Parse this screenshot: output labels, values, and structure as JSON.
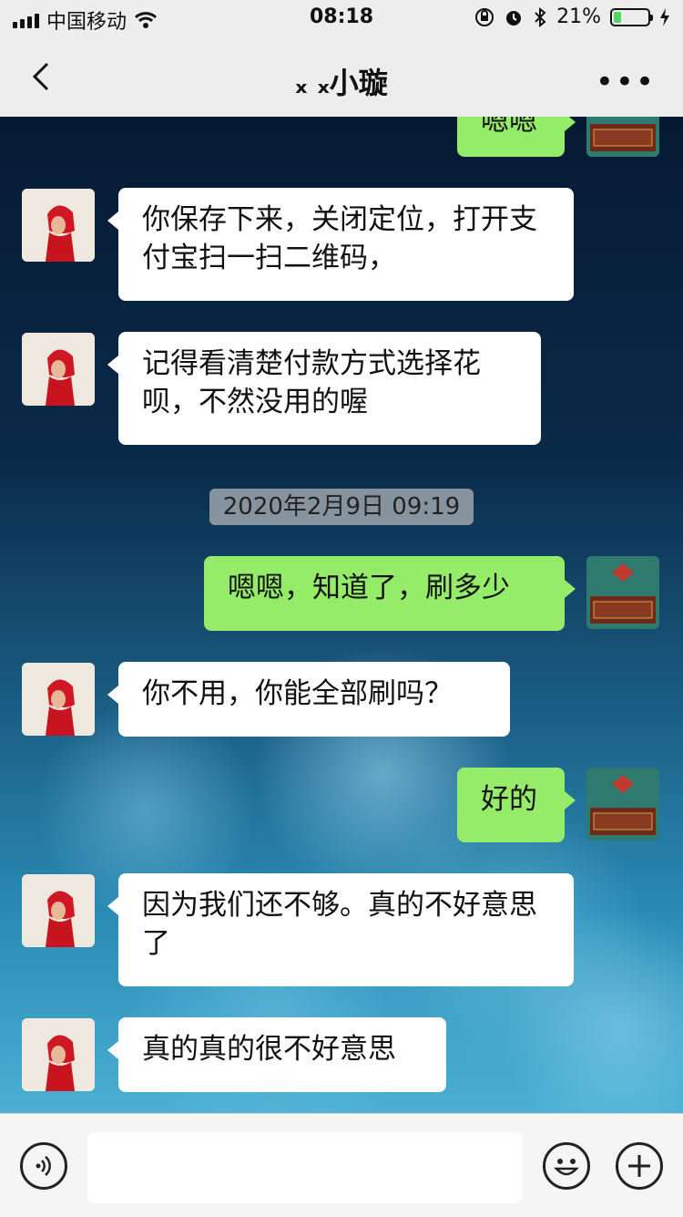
{
  "status_bar": {
    "carrier": "中国移动",
    "time": "08:18",
    "battery_percent": "21%",
    "battery_level": 0.21
  },
  "header": {
    "title": "ₓ ₓ小璇"
  },
  "messages": [
    {
      "side": "out",
      "text": "嗯嗯"
    },
    {
      "side": "in",
      "text": "你保存下来，关闭定位，打开支付宝扫一扫二维码，"
    },
    {
      "side": "in",
      "text": "记得看清楚付款方式选择花呗，不然没用的喔"
    },
    {
      "side": "out",
      "text": "嗯嗯，知道了，刷多少"
    },
    {
      "side": "in",
      "text": "你不用，你能全部刷吗？"
    },
    {
      "side": "out",
      "text": "好的"
    },
    {
      "side": "in",
      "text": "因为我们还不够。真的不好意思了"
    },
    {
      "side": "in",
      "text": "真的真的很不好意思"
    }
  ],
  "timestamp": "2020年2月9日 09:19",
  "colors": {
    "incoming_bubble": "#ffffff",
    "outgoing_bubble": "#95ec69",
    "nav_background": "#ededed"
  },
  "icons": [
    "back-chevron-icon",
    "more-icon",
    "voice-icon",
    "emoji-icon",
    "plus-icon",
    "wifi-icon",
    "alarm-icon",
    "bluetooth-icon",
    "lock-rotation-icon",
    "charging-icon"
  ]
}
